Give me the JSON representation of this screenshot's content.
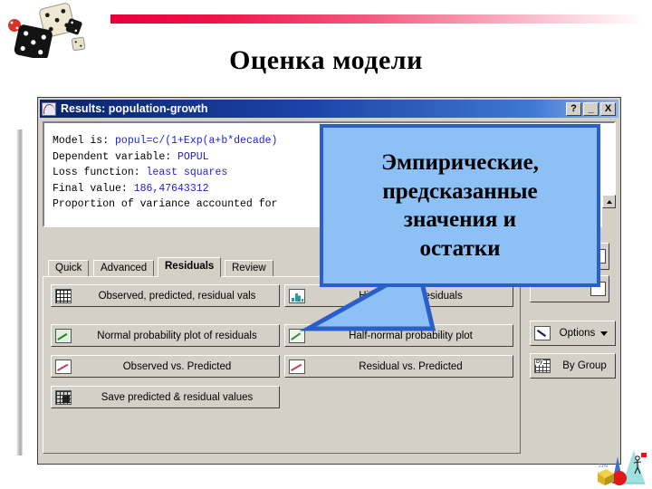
{
  "slide": {
    "title": "Оценка модели",
    "accent_color": "#e8003c",
    "decor_icon_top_left": "dice-clipart",
    "decor_icon_bottom_right": "3d-shapes-clipart"
  },
  "callout": {
    "lines": [
      "Эмпирические,",
      "предсказанные",
      "значения и",
      "остатки"
    ],
    "fill_color": "#8dc0f5",
    "border_color": "#2a5fc9"
  },
  "dialog": {
    "title": "Results: population-growth",
    "title_bar_color": "#0a246a",
    "titlebar_buttons": [
      {
        "name": "help",
        "glyph": "?"
      },
      {
        "name": "minimize",
        "glyph": "_"
      },
      {
        "name": "close",
        "glyph": "X"
      }
    ],
    "results_text": [
      {
        "label": "Model is: ",
        "value": "popul=c/(1+Exp(a+b*decade)"
      },
      {
        "label": "Dependent variable: ",
        "value": "POPUL"
      },
      {
        "label": "Loss function: ",
        "value": "least squares"
      },
      {
        "label": "Final value: ",
        "value": "186,47643312"
      },
      {
        "label": "Proportion of variance accounted for",
        "value": ""
      }
    ],
    "tabs": [
      {
        "label": "Quick",
        "active": false
      },
      {
        "label": "Advanced",
        "active": false
      },
      {
        "label": "Residuals",
        "active": true
      },
      {
        "label": "Review",
        "active": false
      }
    ],
    "buttons_left": [
      {
        "label": "Observed, predicted, residual vals",
        "icon": "spreadsheet-grid-icon",
        "accel": "e"
      },
      {
        "label": "Normal probability plot of residuals",
        "icon": "normal-plot-icon",
        "accel": "N"
      },
      {
        "label": "Observed vs. Predicted",
        "icon": "scatter-plot-icon",
        "accel": "b"
      },
      {
        "label": "Save predicted & residual values",
        "icon": "save-grid-icon",
        "accel": "S"
      }
    ],
    "buttons_right": [
      {
        "label": "Histogram of residuals",
        "icon": "histogram-icon",
        "accel": "i"
      },
      {
        "label": "Half-normal probability plot",
        "icon": "half-normal-plot-icon",
        "accel": "H"
      },
      {
        "label": "Residual vs. Predicted",
        "icon": "scatter-plot-icon",
        "accel": "u"
      }
    ],
    "buttons_side": [
      {
        "label": "Options",
        "icon": "options-arrow-icon",
        "has_caret": true
      },
      {
        "label": "By Group",
        "icon": "by-group-icon",
        "has_caret": false
      }
    ],
    "scroll": {
      "up_arrow": "▲"
    }
  }
}
